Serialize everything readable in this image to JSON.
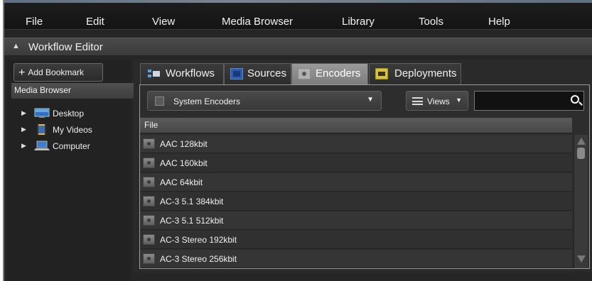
{
  "menu": [
    "File",
    "Edit",
    "View",
    "Media Browser",
    "Library",
    "Tools",
    "Help"
  ],
  "section": {
    "title": "Workflow Editor"
  },
  "left": {
    "add_bookmark": "Add Bookmark",
    "media_browser": "Media Browser",
    "tree": [
      {
        "label": "Desktop",
        "icon": "desktop-icon"
      },
      {
        "label": "My Videos",
        "icon": "videos-folder-icon"
      },
      {
        "label": "Computer",
        "icon": "computer-icon"
      }
    ]
  },
  "tabs": [
    {
      "label": "Workflows",
      "icon": "workflows-icon",
      "active": false
    },
    {
      "label": "Sources",
      "icon": "sources-icon",
      "active": false
    },
    {
      "label": "Encoders",
      "icon": "encoders-icon",
      "active": true
    },
    {
      "label": "Deployments",
      "icon": "deployments-icon",
      "active": false
    }
  ],
  "toolbar": {
    "dropdown_value": "System Encoders",
    "views_label": "Views",
    "search_value": ""
  },
  "table": {
    "header": "File",
    "rows": [
      "AAC 128kbit",
      "AAC 160kbit",
      "AAC 64kbit",
      "AC-3 5.1 384kbit",
      "AC-3 5.1 512kbit",
      "AC-3 Stereo 192kbit",
      "AC-3 Stereo 256kbit"
    ]
  },
  "colors": {
    "background": "#262626",
    "active_tab": "#8a8a8a",
    "panel_border": "#9a9a9a"
  }
}
